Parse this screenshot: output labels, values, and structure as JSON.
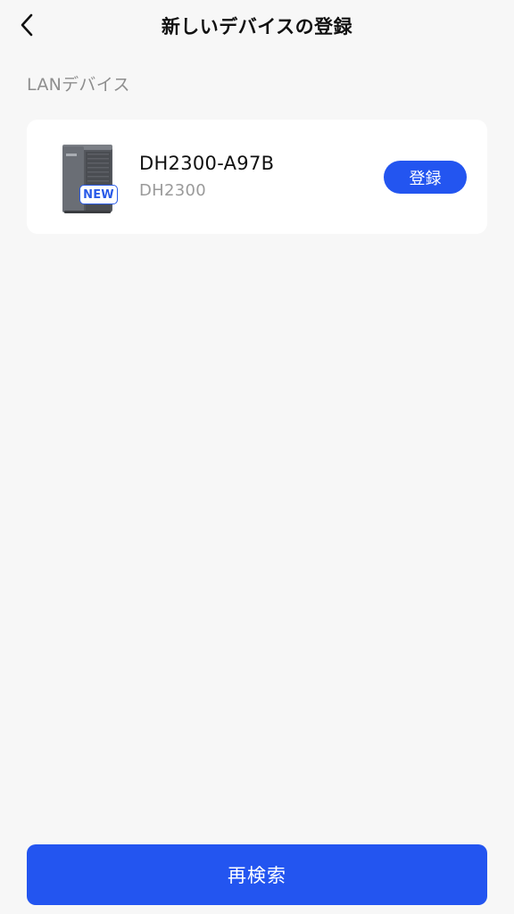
{
  "header": {
    "title": "新しいデバイスの登録",
    "back_icon": "chevron-left-icon"
  },
  "section": {
    "label": "LANデバイス"
  },
  "devices": [
    {
      "name": "DH2300-A97B",
      "model": "DH2300",
      "badge": "NEW",
      "register_label": "登録",
      "image_icon": "nas-device-icon"
    }
  ],
  "footer": {
    "rescan_label": "再検索"
  },
  "colors": {
    "accent": "#2355f0",
    "background": "#f7f7f7",
    "card": "#ffffff",
    "secondary_text": "#9a9a9a"
  }
}
